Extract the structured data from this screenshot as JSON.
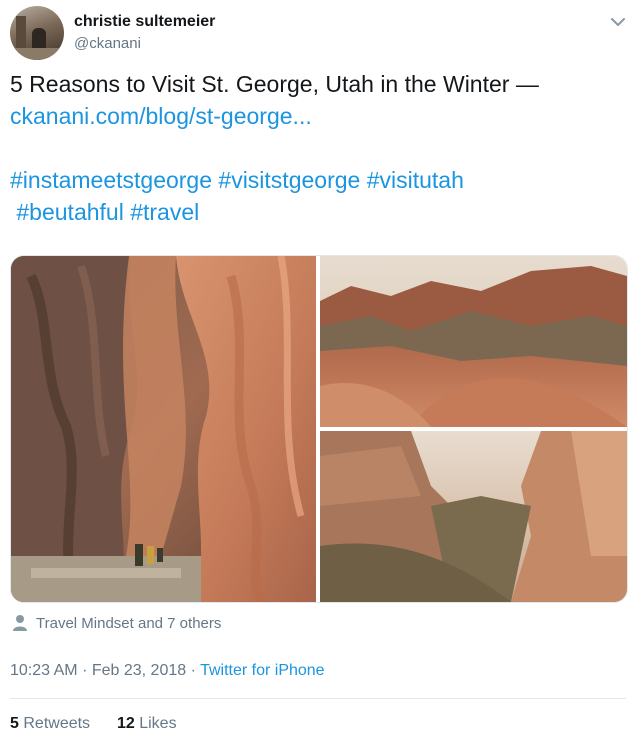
{
  "author": {
    "name": "christie sultemeier",
    "handle": "@ckanani"
  },
  "tweet": {
    "text_line": "5 Reasons to Visit St. George, Utah in the Winter —",
    "link": "ckanani.com/blog/st-george...",
    "hashtags_line1": [
      "#instameetstgeorge",
      "#visitstgeorge",
      "#visitutah"
    ],
    "hashtags_line2": [
      "#beutahful",
      "#travel"
    ]
  },
  "media": {
    "images": [
      "slot-canyon-photo",
      "red-rock-landscape-photo",
      "canyon-overlook-photo"
    ]
  },
  "likers": {
    "text": "Travel Mindset and 7 others",
    "icon": "user-icon"
  },
  "meta": {
    "time": "10:23 AM",
    "separator": "·",
    "date": "Feb 23, 2018",
    "source": "Twitter for iPhone"
  },
  "stats": {
    "retweets_count": "5",
    "retweets_label": "Retweets",
    "likes_count": "12",
    "likes_label": "Likes"
  },
  "colors": {
    "link": "#1b95e0",
    "secondary_text": "#657786",
    "primary_text": "#14171a"
  }
}
